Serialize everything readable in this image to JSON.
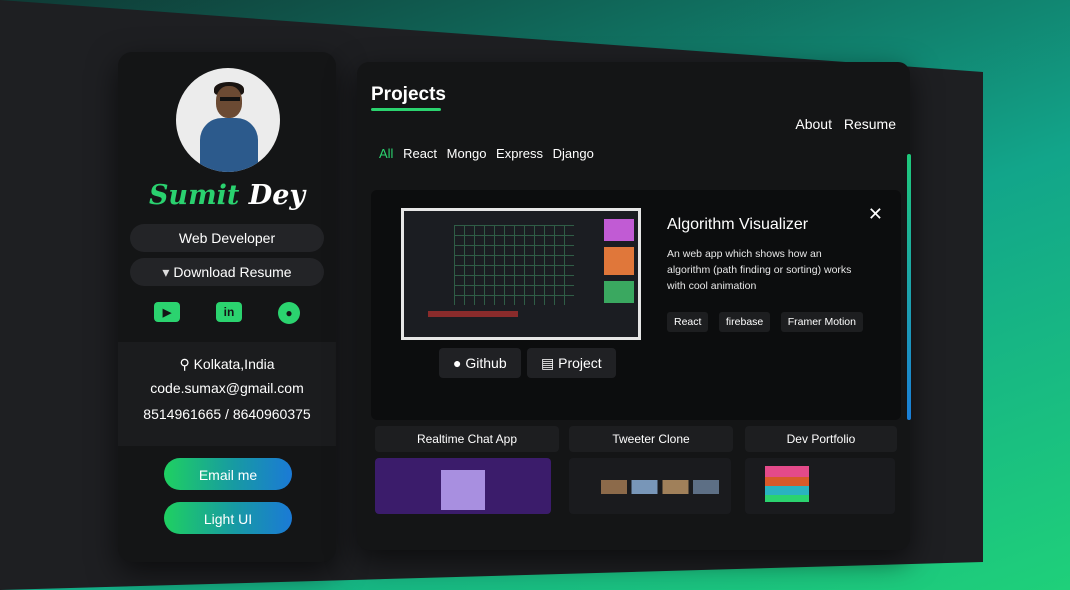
{
  "profile": {
    "first_name": "Sumit",
    "last_name": "Dey",
    "role": "Web Developer",
    "download_label": "Download Resume",
    "social": [
      {
        "name": "youtube",
        "icon": "youtube-icon"
      },
      {
        "name": "linkedin",
        "icon": "linkedin-icon",
        "glyph": "in"
      },
      {
        "name": "github",
        "icon": "github-icon"
      }
    ],
    "location": "Kolkata,India",
    "email": "code.sumax@gmail.com",
    "phone": "8514961665 / 8640960375",
    "email_button": "Email me",
    "theme_button": "Light UI"
  },
  "main": {
    "title": "Projects",
    "nav": [
      "About",
      "Resume"
    ],
    "filters": [
      {
        "label": "All",
        "active": true
      },
      {
        "label": "React",
        "active": false
      },
      {
        "label": "Mongo",
        "active": false
      },
      {
        "label": "Express",
        "active": false
      },
      {
        "label": "Django",
        "active": false
      }
    ],
    "modal": {
      "title": "Algorithm Visualizer",
      "description": "An web app which shows how an algorithm (path finding or sorting) works with cool animation",
      "tags": [
        "React",
        "firebase",
        "Framer Motion"
      ],
      "github_label": "Github",
      "project_label": "Project"
    },
    "cards": [
      "Realtime Chat App",
      "Tweeter Clone",
      "Dev Portfolio"
    ]
  },
  "colors": {
    "accent": "#2bd36f",
    "panel": "#141516",
    "background": "#1e1f22"
  }
}
